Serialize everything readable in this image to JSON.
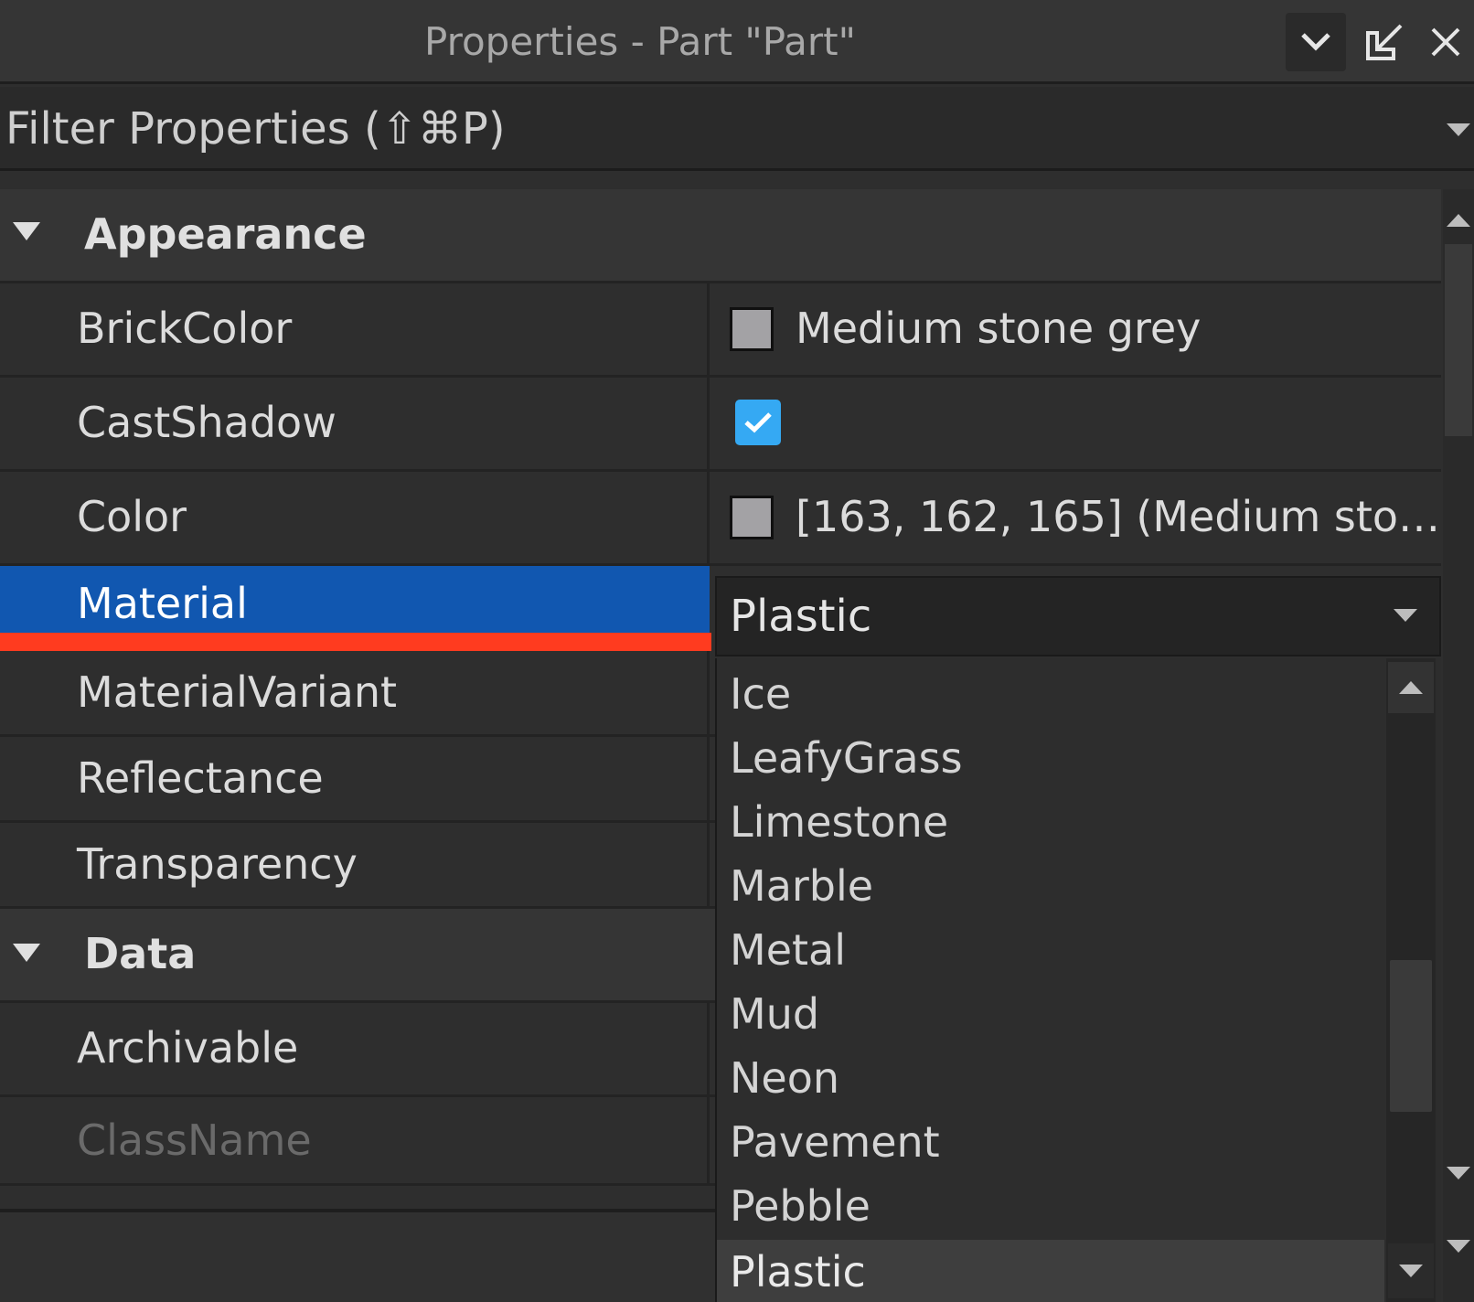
{
  "window": {
    "title": "Properties - Part \"Part\""
  },
  "filter": {
    "placeholder": "Filter Properties (⇧⌘P)"
  },
  "categories": {
    "appearance": "Appearance",
    "data": "Data"
  },
  "properties": {
    "brick_color": {
      "name": "BrickColor",
      "value": "Medium stone grey",
      "swatch": "#a3a2a5"
    },
    "cast_shadow": {
      "name": "CastShadow",
      "checked": true
    },
    "color": {
      "name": "Color",
      "value": "[163, 162, 165] (Medium sto…",
      "swatch": "#a3a2a5"
    },
    "material": {
      "name": "Material",
      "value": "Plastic"
    },
    "material_variant": {
      "name": "MaterialVariant"
    },
    "reflectance": {
      "name": "Reflectance"
    },
    "transparency": {
      "name": "Transparency"
    },
    "archivable": {
      "name": "Archivable"
    },
    "class_name": {
      "name": "ClassName"
    }
  },
  "material_options": [
    "Ice",
    "LeafyGrass",
    "Limestone",
    "Marble",
    "Metal",
    "Mud",
    "Neon",
    "Pavement",
    "Pebble",
    "Plastic"
  ],
  "selected_material": "Plastic",
  "colors": {
    "selection": "#1157b0",
    "highlight_underline": "#ff3b1f",
    "checkbox": "#35a9f3"
  }
}
